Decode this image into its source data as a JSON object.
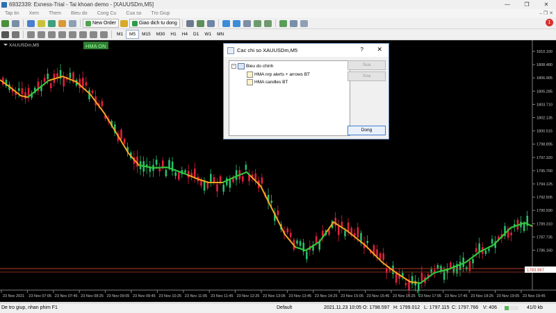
{
  "window": {
    "title": "6932339: Exness-Trial - Tai khoan demo - [XAUUSDm,M5]"
  },
  "menu": [
    "Tap tin",
    "Xem",
    "Them",
    "Bieu do",
    "Cong Cu",
    "Cua so",
    "Tro Giup"
  ],
  "toolbar": {
    "new_order_label": "New Order",
    "algo_label": "Giao dich tu dong",
    "timeframes": [
      "M1",
      "M5",
      "M15",
      "M30",
      "H1",
      "H4",
      "D1",
      "W1",
      "MN"
    ],
    "active_timeframe": "M5",
    "notification_count": "1"
  },
  "chart": {
    "symbol_label": "XAUUSDm,M5",
    "badge": "HMA ON",
    "price_labels": [
      "1810.100",
      "1808.480",
      "1806.905",
      "1805.285",
      "1803.710",
      "1802.135",
      "1800.515",
      "1798.895",
      "1797.320",
      "1795.700",
      "1794.125",
      "1792.505",
      "1790.930",
      "1789.310",
      "1787.735",
      "1786.160",
      "1782.920"
    ],
    "current_price": "1783.967",
    "time_labels": [
      "23 Nov 2021",
      "23 Nov 07:05",
      "23 Nov 07:45",
      "23 Nov 08:25",
      "23 Nov 09:05",
      "23 Nov 09:45",
      "23 Nov 10:25",
      "23 Nov 11:05",
      "23 Nov 11:45",
      "23 Nov 12:25",
      "23 Nov 13:05",
      "23 Nov 13:45",
      "23 Nov 14:25",
      "23 Nov 15:05",
      "23 Nov 15:45",
      "23 Nov 16:25",
      "23 Nov 17:05",
      "23 Nov 17:45",
      "23 Nov 18:25",
      "23 Nov 19:05",
      "23 Nov 19:45"
    ],
    "colors": {
      "background": "#000000",
      "bull": "#26c06a",
      "bear": "#e0213a",
      "hma_down": "#f5a623",
      "hma_up": "#27c93f",
      "price_line": "#c0392b"
    }
  },
  "dialog": {
    "title": "Cac chi so XAUUSDm,M5",
    "help": "?",
    "close": "✕",
    "tree_root": "Bieu do chinh",
    "indicators": [
      "HMA nrp alerts + arrows BT",
      "HMA candles  BT"
    ],
    "buttons": {
      "edit": "Sua",
      "delete": "Xoa",
      "close": "Dong"
    }
  },
  "status": {
    "help_text": "De tro giup, nhan phim F1",
    "profile": "Default",
    "datetime": "2021.11.23 10:05",
    "open": "O: 1798.597",
    "high": "H: 1799.012",
    "low": "L: 1797.115",
    "close": "C: 1797.766",
    "volume": "V: 406",
    "traffic": "41/0 kb"
  }
}
